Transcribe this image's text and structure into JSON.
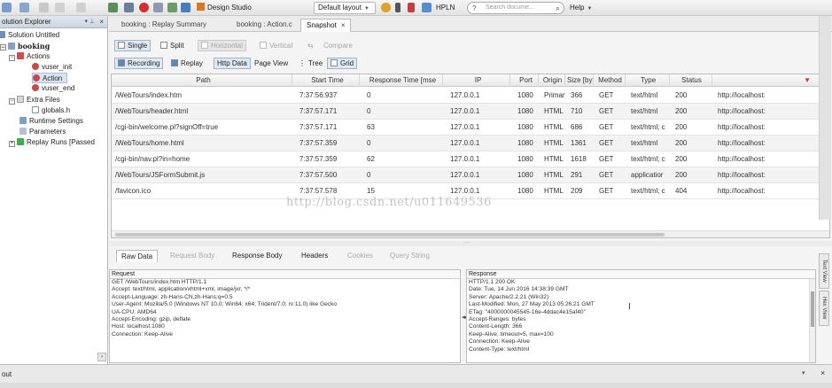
{
  "toolbar": {
    "design_studio": "Design Studio",
    "layout": "Default layout",
    "hpln": "HPLN",
    "search_placeholder": "Search docume...",
    "help": "Help"
  },
  "solution_explorer": {
    "title": "olution Explorer",
    "solution": "Solution Untitled",
    "script": "booking",
    "actions": "Actions",
    "vuser_init": "vuser_init",
    "action": "Action",
    "vuser_end": "vuser_end",
    "extra_files": "Extra Files",
    "globals": "globals.h",
    "runtime_settings": "Runtime Settings",
    "parameters": "Parameters",
    "replay_runs": "Replay Runs [Passed"
  },
  "doc_tabs": [
    "booking : Replay Summary",
    "booking : Action.c",
    "Snapshot"
  ],
  "view_buttons": {
    "single": "Single",
    "split": "Split",
    "horizontal": "Horizontal",
    "vertical": "Vertical",
    "compare": "Compare"
  },
  "mode_buttons": {
    "recording": "Recording",
    "replay": "Replay",
    "http_data": "Http Data",
    "page_view": "Page View",
    "tree": "Tree",
    "grid": "Grid"
  },
  "grid": {
    "columns": [
      "Path",
      "Start Time",
      "Response Time [mse",
      "IP",
      "Port",
      "Origin",
      "Size [byte",
      "Method",
      "Type",
      "Status",
      ""
    ],
    "rows": [
      [
        "/WebTours/index.htm",
        "7:37:56.937",
        "0",
        "127.0.0.1",
        "1080",
        "Primary",
        "366",
        "GET",
        "text/html",
        "200",
        "http://localhost:"
      ],
      [
        "/WebTours/header.html",
        "7:37:57.171",
        "0",
        "127.0.0.1",
        "1080",
        "HTML",
        "710",
        "GET",
        "text/html",
        "200",
        "http://localhost:"
      ],
      [
        "/cgi-bin/welcome.pl?signOff=true",
        "7:37:57.171",
        "63",
        "127.0.0.1",
        "1080",
        "HTML",
        "686",
        "GET",
        "text/html; c",
        "200",
        "http://localhost:"
      ],
      [
        "/WebTours/home.html",
        "7:37:57.359",
        "0",
        "127.0.0.1",
        "1080",
        "HTML",
        "1361",
        "GET",
        "text/html",
        "200",
        "http://localhost:"
      ],
      [
        "/cgi-bin/nav.pl?in=home",
        "7:37:57.359",
        "62",
        "127.0.0.1",
        "1080",
        "HTML",
        "1618",
        "GET",
        "text/html; c",
        "200",
        "http://localhost:"
      ],
      [
        "/WebTours/JSFormSubmit.js",
        "7:37:57.500",
        "0",
        "127.0.0.1",
        "1080",
        "HTML",
        "291",
        "GET",
        "applicatior",
        "200",
        "http://localhost:"
      ],
      [
        "/favicon.ico",
        "7:37:57.578",
        "15",
        "127.0.0.1",
        "1080",
        "HTML",
        "209",
        "GET",
        "text/html; c",
        "404",
        "http://localhost:"
      ]
    ]
  },
  "panel_tabs": [
    "Raw Data",
    "Request Body",
    "Response Body",
    "Headers",
    "Cookies",
    "Query String"
  ],
  "request": {
    "title": "Request",
    "lines": [
      "GET /WebTours/index.htm HTTP/1.1",
      "Accept: text/html, application/xhtml+xml, image/jxr, */*",
      "Accept-Language: zh-Hans-CN,zh-Hans;q=0.5",
      "User-Agent: Mozilla/5.0 (Windows NT 10.0; Win64; x64; Trident/7.0; rv:11.0) like Gecko",
      "UA-CPU: AMD64",
      "Accept-Encoding: gzip, deflate",
      "Host: localhost:1080",
      "Connection: Keep-Alive"
    ]
  },
  "response": {
    "title": "Response",
    "lines": [
      "HTTP/1.1 200 OK",
      "Date: Tue, 14 Jun 2016 14:38:39 GMT",
      "Server: Apache/2.2.21 (Win32)",
      "Last-Modified: Mon, 27 May 2013 05:26:21 GMT",
      "ETag: \"4000000045545-16e-4ddac4e15af40\"",
      "Accept-Ranges: bytes",
      "Content-Length: 366",
      "Keep-Alive: timeout=5, max=100",
      "Connection: Keep-Alive",
      "Content-Type: text/html"
    ]
  },
  "side_tabs": [
    "Text View",
    "Hex View"
  ],
  "bottom": {
    "output": "out"
  },
  "watermark": "http://blog.csdn.net/u011649536"
}
